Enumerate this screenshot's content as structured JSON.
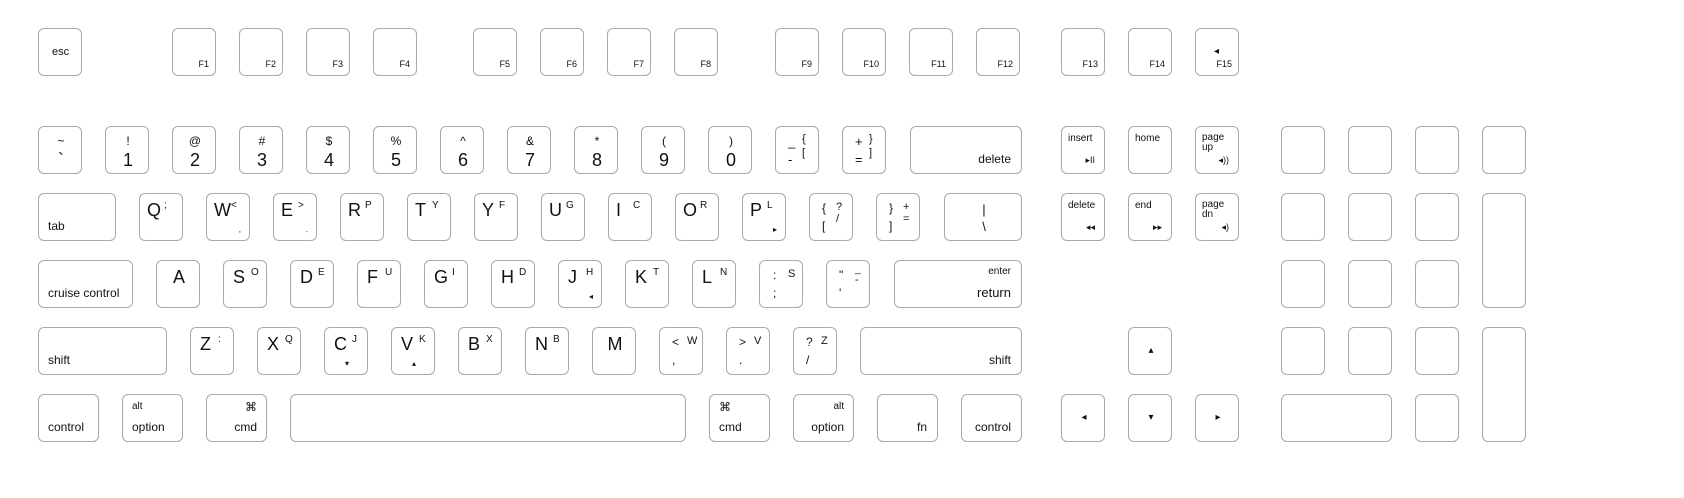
{
  "layout_name": "",
  "rows": {
    "function": [
      {
        "id": "esc",
        "legends": [
          "esc"
        ]
      },
      {
        "id": "f1",
        "legends": [
          "F1"
        ]
      },
      {
        "id": "f2",
        "legends": [
          "F2"
        ]
      },
      {
        "id": "f3",
        "legends": [
          "F3"
        ]
      },
      {
        "id": "f4",
        "legends": [
          "F4"
        ]
      },
      {
        "id": "f5",
        "legends": [
          "F5"
        ]
      },
      {
        "id": "f6",
        "legends": [
          "F6"
        ]
      },
      {
        "id": "f7",
        "legends": [
          "F7"
        ]
      },
      {
        "id": "f8",
        "legends": [
          "F8"
        ]
      },
      {
        "id": "f9",
        "legends": [
          "F9"
        ]
      },
      {
        "id": "f10",
        "legends": [
          "F10"
        ]
      },
      {
        "id": "f11",
        "legends": [
          "F11"
        ]
      },
      {
        "id": "f12",
        "legends": [
          "F12"
        ]
      },
      {
        "id": "f13",
        "legends": [
          "F13"
        ]
      },
      {
        "id": "f14",
        "legends": [
          "F14"
        ]
      },
      {
        "id": "f15",
        "legends": [
          "◂",
          "F15"
        ]
      }
    ],
    "number": [
      {
        "id": "tilde",
        "legends": [
          "~",
          "`"
        ]
      },
      {
        "id": "1",
        "legends": [
          "!",
          "1"
        ]
      },
      {
        "id": "2",
        "legends": [
          "@",
          "2"
        ]
      },
      {
        "id": "3",
        "legends": [
          "#",
          "3"
        ]
      },
      {
        "id": "4",
        "legends": [
          "$",
          "4"
        ]
      },
      {
        "id": "5",
        "legends": [
          "%",
          "5"
        ]
      },
      {
        "id": "6",
        "legends": [
          "^",
          "6"
        ]
      },
      {
        "id": "7",
        "legends": [
          "&",
          "7"
        ]
      },
      {
        "id": "8",
        "legends": [
          "*",
          "8"
        ]
      },
      {
        "id": "9",
        "legends": [
          "(",
          "9"
        ]
      },
      {
        "id": "0",
        "legends": [
          ")",
          "0"
        ]
      },
      {
        "id": "minus",
        "legends": [
          "_",
          "-",
          "{",
          "["
        ]
      },
      {
        "id": "equals",
        "legends": [
          "+",
          "=",
          "}",
          "]"
        ]
      },
      {
        "id": "delete",
        "legends": [
          "delete"
        ]
      }
    ],
    "top": [
      {
        "id": "tab",
        "legends": [
          "tab"
        ]
      },
      {
        "id": "q",
        "legends": [
          "Q",
          ";"
        ]
      },
      {
        "id": "w",
        "legends": [
          "W",
          "<",
          ","
        ]
      },
      {
        "id": "e",
        "legends": [
          "E",
          ">",
          "."
        ]
      },
      {
        "id": "r",
        "legends": [
          "R",
          "P"
        ]
      },
      {
        "id": "t",
        "legends": [
          "T",
          "Y"
        ]
      },
      {
        "id": "y",
        "legends": [
          "Y",
          "F"
        ]
      },
      {
        "id": "u",
        "legends": [
          "U",
          "G"
        ]
      },
      {
        "id": "i",
        "legends": [
          "I",
          "C"
        ]
      },
      {
        "id": "o",
        "legends": [
          "O",
          "R"
        ]
      },
      {
        "id": "p",
        "legends": [
          "P",
          "L",
          "▸"
        ]
      },
      {
        "id": "lbracket",
        "legends": [
          "{",
          "[",
          "?",
          "/"
        ]
      },
      {
        "id": "rbracket",
        "legends": [
          "}",
          "]",
          "+",
          "="
        ]
      },
      {
        "id": "backslash",
        "legends": [
          "|",
          "\\"
        ]
      }
    ],
    "home": [
      {
        "id": "cruise",
        "legends": [
          "cruise control"
        ]
      },
      {
        "id": "a",
        "legends": [
          "A"
        ]
      },
      {
        "id": "s",
        "legends": [
          "S",
          "O"
        ]
      },
      {
        "id": "d",
        "legends": [
          "D",
          "E"
        ]
      },
      {
        "id": "f",
        "legends": [
          "F",
          "U"
        ]
      },
      {
        "id": "g",
        "legends": [
          "G",
          "I"
        ]
      },
      {
        "id": "h",
        "legends": [
          "H",
          "D"
        ]
      },
      {
        "id": "j",
        "legends": [
          "J",
          "H",
          "◂"
        ]
      },
      {
        "id": "k",
        "legends": [
          "K",
          "T"
        ]
      },
      {
        "id": "l",
        "legends": [
          "L",
          "N"
        ]
      },
      {
        "id": "semicolon",
        "legends": [
          ":",
          ";",
          "S"
        ]
      },
      {
        "id": "quote",
        "legends": [
          "\"",
          "'",
          "_",
          "-"
        ]
      },
      {
        "id": "return",
        "legends": [
          "enter",
          "return"
        ]
      }
    ],
    "bottom": [
      {
        "id": "lshift",
        "legends": [
          "shift"
        ]
      },
      {
        "id": "z",
        "legends": [
          "Z",
          ":"
        ]
      },
      {
        "id": "x",
        "legends": [
          "X",
          "Q"
        ]
      },
      {
        "id": "c",
        "legends": [
          "C",
          "J",
          "▾"
        ]
      },
      {
        "id": "v",
        "legends": [
          "V",
          "K",
          "▴"
        ]
      },
      {
        "id": "b",
        "legends": [
          "B",
          "X"
        ]
      },
      {
        "id": "n",
        "legends": [
          "N",
          "B"
        ]
      },
      {
        "id": "m",
        "legends": [
          "M"
        ]
      },
      {
        "id": "comma",
        "legends": [
          "<",
          ",",
          "W"
        ]
      },
      {
        "id": "period",
        "legends": [
          ">",
          ".",
          "V"
        ]
      },
      {
        "id": "slash",
        "legends": [
          "?",
          "/",
          "Z"
        ]
      },
      {
        "id": "rshift",
        "legends": [
          "shift"
        ]
      }
    ],
    "space": [
      {
        "id": "lcontrol",
        "legends": [
          "control"
        ]
      },
      {
        "id": "loption",
        "legends": [
          "alt",
          "option"
        ]
      },
      {
        "id": "lcmd",
        "legends": [
          "⌘",
          "cmd"
        ]
      },
      {
        "id": "space",
        "legends": []
      },
      {
        "id": "rcmd",
        "legends": [
          "⌘",
          "cmd"
        ]
      },
      {
        "id": "roption",
        "legends": [
          "alt",
          "option"
        ]
      },
      {
        "id": "fn",
        "legends": [
          "fn"
        ]
      },
      {
        "id": "rcontrol",
        "legends": [
          "control"
        ]
      }
    ]
  },
  "navigation": [
    {
      "id": "insert",
      "legends": [
        "insert",
        "▸II"
      ]
    },
    {
      "id": "home",
      "legends": [
        "home"
      ]
    },
    {
      "id": "pageup",
      "legends": [
        "page",
        "up",
        "◂))"
      ]
    },
    {
      "id": "fwd-delete",
      "legends": [
        "delete",
        "◂◂"
      ]
    },
    {
      "id": "end",
      "legends": [
        "end",
        "▸▸"
      ]
    },
    {
      "id": "pagedn",
      "legends": [
        "page",
        "dn",
        "◂)"
      ]
    }
  ],
  "arrows": [
    {
      "id": "up",
      "legends": [
        "▴"
      ]
    },
    {
      "id": "left",
      "legends": [
        "◂"
      ]
    },
    {
      "id": "down",
      "legends": [
        "▾"
      ]
    },
    {
      "id": "right",
      "legends": [
        "▸"
      ]
    }
  ],
  "numpad_keys": 17
}
